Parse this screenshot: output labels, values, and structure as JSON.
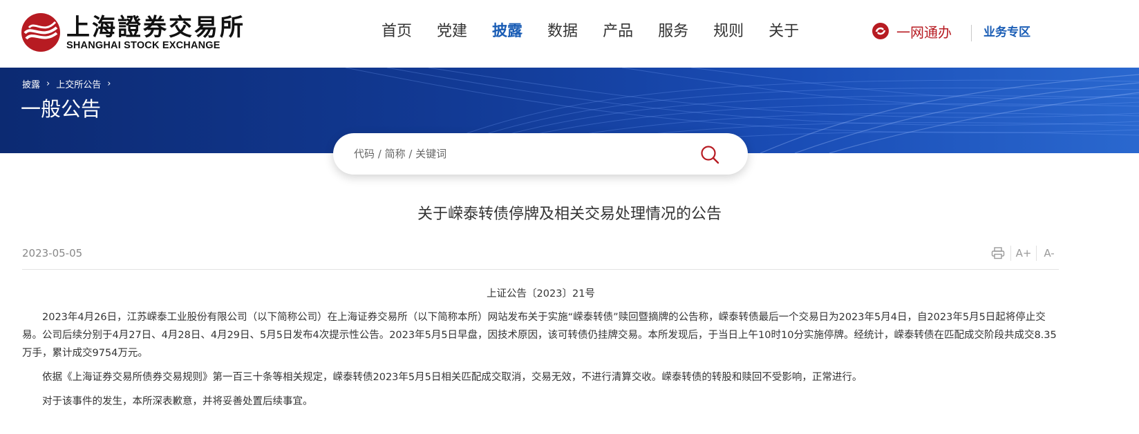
{
  "header": {
    "logo_cn": "上海證券交易所",
    "logo_en": "SHANGHAI STOCK EXCHANGE",
    "nav": [
      {
        "label": "首页",
        "active": false
      },
      {
        "label": "党建",
        "active": false
      },
      {
        "label": "披露",
        "active": true
      },
      {
        "label": "数据",
        "active": false
      },
      {
        "label": "产品",
        "active": false
      },
      {
        "label": "服务",
        "active": false
      },
      {
        "label": "规则",
        "active": false
      },
      {
        "label": "关于",
        "active": false
      }
    ],
    "one_net_label": "一网通办",
    "business_label": "业务专区"
  },
  "banner": {
    "breadcrumb": [
      "披露",
      "上交所公告"
    ],
    "title": "一般公告"
  },
  "search": {
    "placeholder": "代码 / 简称 / 关键词",
    "icon": "search-icon"
  },
  "article": {
    "title": "关于嵘泰转债停牌及相关交易处理情况的公告",
    "date": "2023-05-05",
    "tools": {
      "print_icon": "print-icon",
      "font_increase": "A+",
      "font_decrease": "A-"
    },
    "doc_no": "上证公告〔2023〕21号",
    "paragraphs": [
      "2023年4月26日，江苏嵘泰工业股份有限公司（以下简称公司）在上海证券交易所（以下简称本所）网站发布关于实施“嵘泰转债”赎回暨摘牌的公告称，嵘泰转债最后一个交易日为2023年5月4日，自2023年5月5日起将停止交易。公司后续分别于4月27日、4月28日、4月29日、5月5日发布4次提示性公告。2023年5月5日早盘，因技术原因，该可转债仍挂牌交易。本所发现后，于当日上午10时10分实施停牌。经统计，嵘泰转债在匹配成交阶段共成交8.35万手，累计成交9754万元。",
      "依据《上海证券交易所债券交易规则》第一百三十条等相关规定，嵘泰转债2023年5月5日相关匹配成交取消，交易无效，不进行清算交收。嵘泰转债的转股和赎回不受影响，正常进行。",
      "对于该事件的发生，本所深表歉意，并将妥善处置后续事宜。"
    ]
  },
  "colors": {
    "brand_red": "#b71b22",
    "link_blue": "#1a5db5",
    "banner_dark": "#0c2a72",
    "banner_light": "#2a68cf"
  }
}
